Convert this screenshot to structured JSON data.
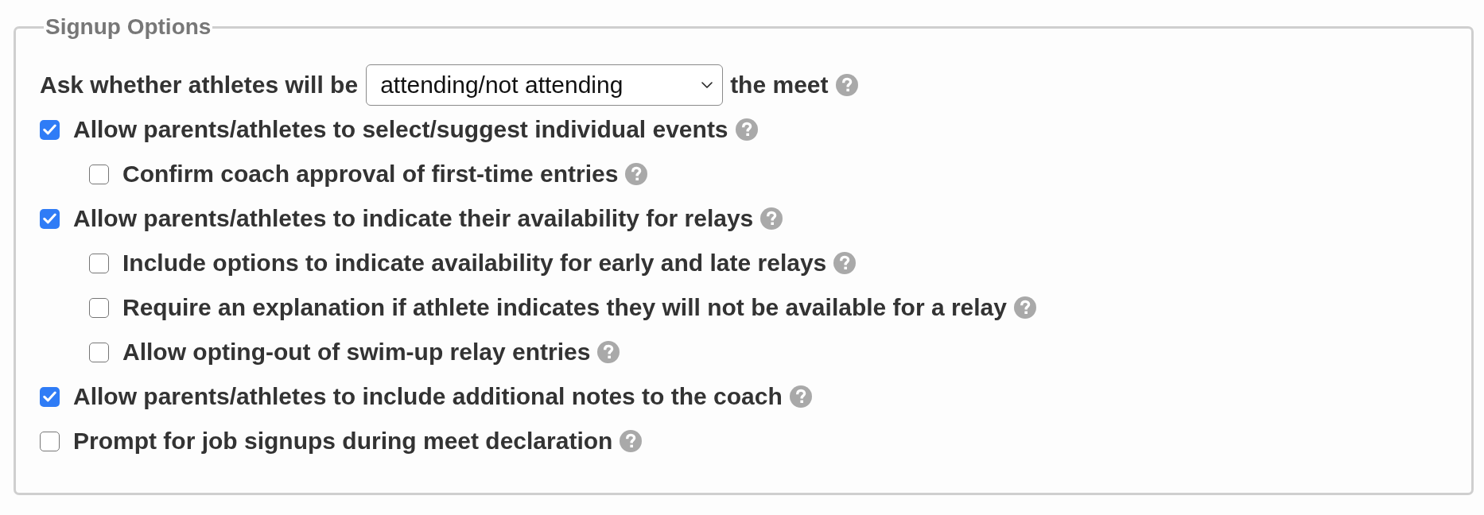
{
  "panel": {
    "legend": "Signup Options"
  },
  "attendance_row": {
    "label": "Ask whether athletes will be",
    "dropdown": {
      "value": "attending/not attending"
    },
    "suffix": "the meet"
  },
  "options": [
    {
      "label": "Allow parents/athletes to select/suggest individual events",
      "checked": true,
      "children": [
        {
          "label": "Confirm coach approval of first-time entries",
          "checked": false
        }
      ]
    },
    {
      "label": "Allow parents/athletes to indicate their availability for relays",
      "checked": true,
      "children": [
        {
          "label": "Include options to indicate availability for early and late relays",
          "checked": false
        },
        {
          "label": "Require an explanation if athlete indicates they will not be available for a relay",
          "checked": false
        },
        {
          "label": "Allow opting-out of swim-up relay entries",
          "checked": false
        }
      ]
    },
    {
      "label": "Allow parents/athletes to include additional notes to the coach",
      "checked": true
    },
    {
      "label": "Prompt for job signups during meet declaration",
      "checked": false
    }
  ]
}
